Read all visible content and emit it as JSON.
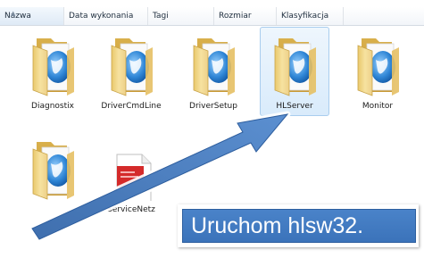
{
  "columns": [
    {
      "key": "name",
      "label": "Nazwa",
      "sorted": true
    },
    {
      "key": "date",
      "label": "Data wykonania"
    },
    {
      "key": "tags",
      "label": "Tagi"
    },
    {
      "key": "size",
      "label": "Rozmiar"
    },
    {
      "key": "class",
      "label": "Klasyfikacja"
    }
  ],
  "items": [
    {
      "label": "Diagnostix",
      "icon": "folder-icon"
    },
    {
      "label": "DriverCmdLine",
      "icon": "folder-icon"
    },
    {
      "label": "DriverSetup",
      "icon": "folder-icon"
    },
    {
      "label": "HLServer",
      "icon": "folder-icon",
      "selected": true
    },
    {
      "label": "Monitor",
      "icon": "folder-icon"
    },
    {
      "label": "",
      "icon": "folder-icon"
    },
    {
      "label": "ServiceNetz",
      "icon": "document-icon"
    }
  ],
  "callout": {
    "text": "Uruchom hlsw32."
  },
  "colors": {
    "arrow": "#4f81bd",
    "callout_bg": "#4a83c9",
    "selection": "#d9ebfb"
  }
}
